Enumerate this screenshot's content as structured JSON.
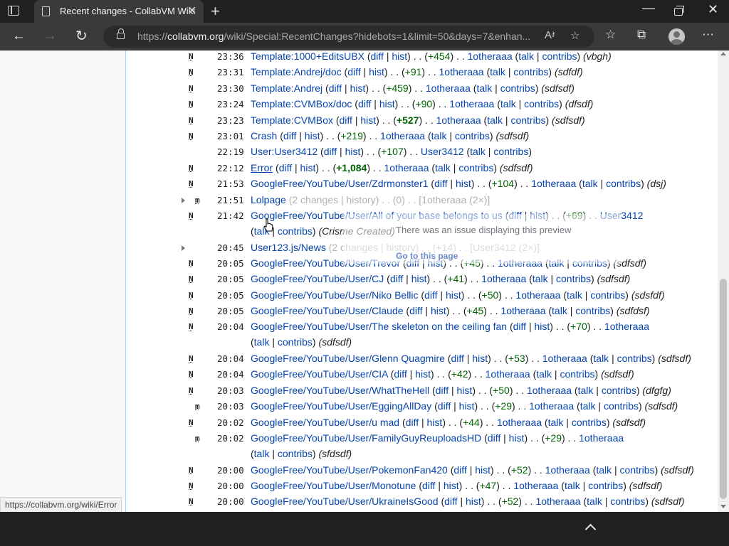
{
  "browser": {
    "tab_title": "Recent changes - CollabVM Wiki",
    "url_scheme": "https://",
    "url_host": "collabvm.org",
    "url_path": "/wiki/Special:RecentChanges?hidebots=1&limit=50&days=7&enhan...",
    "status_url": "https://collabvm.org/wiki/Error"
  },
  "preview": {
    "message": "There was an issue displaying this preview",
    "goto": "Go to this page"
  },
  "rows": [
    {
      "flag": "N",
      "time": "23:36",
      "title": "Template:1000+EditsUBX",
      "diff": "diff",
      "hist": "hist",
      "size": "+454",
      "user": "1otheraaa",
      "talk": "talk",
      "contribs": "contribs",
      "summary": "(vbgh)"
    },
    {
      "flag": "N",
      "time": "23:31",
      "title": "Template:Andrej/doc",
      "diff": "diff",
      "hist": "hist",
      "size": "+91",
      "user": "1otheraaa",
      "talk": "talk",
      "contribs": "contribs",
      "summary": "(sdfdf)"
    },
    {
      "flag": "N",
      "time": "23:30",
      "title": "Template:Andrej",
      "diff": "diff",
      "hist": "hist",
      "size": "+459",
      "user": "1otheraaa",
      "talk": "talk",
      "contribs": "contribs",
      "summary": "(sdfsdf)"
    },
    {
      "flag": "N",
      "time": "23:24",
      "title": "Template:CVMBox/doc",
      "diff": "diff",
      "hist": "hist",
      "size": "+90",
      "user": "1otheraaa",
      "talk": "talk",
      "contribs": "contribs",
      "summary": "(dfsdf)"
    },
    {
      "flag": "N",
      "time": "23:23",
      "title": "Template:CVMBox",
      "diff": "diff",
      "hist": "hist",
      "size": "+527",
      "big": true,
      "user": "1otheraaa",
      "talk": "talk",
      "contribs": "contribs",
      "summary": "(sdfsdf)"
    },
    {
      "flag": "N",
      "time": "23:01",
      "title": "Crash",
      "diff": "diff",
      "hist": "hist",
      "size": "+219",
      "user": "1otheraaa",
      "talk": "talk",
      "contribs": "contribs",
      "summary": "(sdfsdf)"
    },
    {
      "flag": "",
      "time": "22:19",
      "title": "User:User3412",
      "diff": "diff",
      "hist": "hist",
      "size": "+107",
      "user": "User3412",
      "talk": "talk",
      "contribs": "contribs",
      "summary": ""
    },
    {
      "flag": "N",
      "time": "22:12",
      "title": "Error",
      "diff": "diff",
      "hist": "hist",
      "size": "+1,084",
      "big": true,
      "user": "1otheraaa",
      "talk": "talk",
      "contribs": "contribs",
      "summary": "(sdfsdf)"
    },
    {
      "flag": "N",
      "time": "21:53",
      "title": "GoogleFree/YouTube/User/Zdrmonster1",
      "diff": "diff",
      "hist": "hist",
      "size": "+104",
      "user": "1otheraaa",
      "talk": "talk",
      "contribs": "contribs",
      "summary": "(dsj)"
    },
    {
      "flag": "m",
      "group": true,
      "time": "21:51",
      "title": "Lolpage",
      "changes": "(2 changes | history) . . (0) . . [1otheraaa (2×)]"
    },
    {
      "flag": "N",
      "time": "21:42",
      "title": "GoogleFree/YouTube/User/All of your base belongs to us",
      "diff": "diff",
      "hist": "hist",
      "size": "+69",
      "user": "User3412",
      "talk": "talk",
      "contribs": "contribs",
      "summary": "(Crisme Created)",
      "wrap": true
    },
    {
      "flag": "",
      "group": true,
      "time": "20:45",
      "title": "User123.js/News",
      "changes": "(2 changes | history) . . (+14) . . [User3412 (2×)]"
    },
    {
      "flag": "N",
      "time": "20:05",
      "title": "GoogleFree/YouTube/User/Trevor",
      "diff": "diff",
      "hist": "hist",
      "size": "+45",
      "user": "1otheraaa",
      "talk": "talk",
      "contribs": "contribs",
      "summary": "(sdfsdf)"
    },
    {
      "flag": "N",
      "time": "20:05",
      "title": "GoogleFree/YouTube/User/CJ",
      "diff": "diff",
      "hist": "hist",
      "size": "+41",
      "user": "1otheraaa",
      "talk": "talk",
      "contribs": "contribs",
      "summary": "(sdfsdf)"
    },
    {
      "flag": "N",
      "time": "20:05",
      "title": "GoogleFree/YouTube/User/Niko Bellic",
      "diff": "diff",
      "hist": "hist",
      "size": "+50",
      "user": "1otheraaa",
      "talk": "talk",
      "contribs": "contribs",
      "summary": "(sdsfdf)"
    },
    {
      "flag": "N",
      "time": "20:05",
      "title": "GoogleFree/YouTube/User/Claude",
      "diff": "diff",
      "hist": "hist",
      "size": "+45",
      "user": "1otheraaa",
      "talk": "talk",
      "contribs": "contribs",
      "summary": "(sdfdsf)"
    },
    {
      "flag": "N",
      "time": "20:04",
      "title": "GoogleFree/YouTube/User/The skeleton on the ceiling fan",
      "diff": "diff",
      "hist": "hist",
      "size": "+70",
      "user": "1otheraaa",
      "talk": "talk",
      "contribs": "contribs",
      "summary": "(sdfsdf)",
      "wrap": true
    },
    {
      "flag": "N",
      "time": "20:04",
      "title": "GoogleFree/YouTube/User/Glenn Quagmire",
      "diff": "diff",
      "hist": "hist",
      "size": "+53",
      "user": "1otheraaa",
      "talk": "talk",
      "contribs": "contribs",
      "summary": "(sdfsdf)"
    },
    {
      "flag": "N",
      "time": "20:04",
      "title": "GoogleFree/YouTube/User/CIA",
      "diff": "diff",
      "hist": "hist",
      "size": "+42",
      "user": "1otheraaa",
      "talk": "talk",
      "contribs": "contribs",
      "summary": "(sdfsdf)"
    },
    {
      "flag": "N",
      "time": "20:03",
      "title": "GoogleFree/YouTube/User/WhatTheHell",
      "diff": "diff",
      "hist": "hist",
      "size": "+50",
      "user": "1otheraaa",
      "talk": "talk",
      "contribs": "contribs",
      "summary": "(dfgfg)"
    },
    {
      "flag": "m",
      "time": "20:03",
      "title": "GoogleFree/YouTube/User/EggingAllDay",
      "diff": "diff",
      "hist": "hist",
      "size": "+29",
      "user": "1otheraaa",
      "talk": "talk",
      "contribs": "contribs",
      "summary": "(sdfsdf)"
    },
    {
      "flag": "N",
      "time": "20:02",
      "title": "GoogleFree/YouTube/User/u mad",
      "diff": "diff",
      "hist": "hist",
      "size": "+44",
      "user": "1otheraaa",
      "talk": "talk",
      "contribs": "contribs",
      "summary": "(sdfsdf)"
    },
    {
      "flag": "m",
      "time": "20:02",
      "title": "GoogleFree/YouTube/User/FamilyGuyReuploadsHD",
      "diff": "diff",
      "hist": "hist",
      "size": "+29",
      "user": "1otheraaa",
      "talk": "talk",
      "contribs": "contribs",
      "summary": "(sfdsdf)",
      "wrap": true
    },
    {
      "flag": "N",
      "time": "20:00",
      "title": "GoogleFree/YouTube/User/PokemonFan420",
      "diff": "diff",
      "hist": "hist",
      "size": "+52",
      "user": "1otheraaa",
      "talk": "talk",
      "contribs": "contribs",
      "summary": "(sdfsdf)"
    },
    {
      "flag": "N",
      "time": "20:00",
      "title": "GoogleFree/YouTube/User/Monotune",
      "diff": "diff",
      "hist": "hist",
      "size": "+47",
      "user": "1otheraaa",
      "talk": "talk",
      "contribs": "contribs",
      "summary": "(sdfsdf)"
    },
    {
      "flag": "N",
      "time": "20:00",
      "title": "GoogleFree/YouTube/User/UkraineIsGood",
      "diff": "diff",
      "hist": "hist",
      "size": "+52",
      "user": "1otheraaa",
      "talk": "talk",
      "contribs": "contribs",
      "summary": "(sdfsdf)"
    }
  ]
}
